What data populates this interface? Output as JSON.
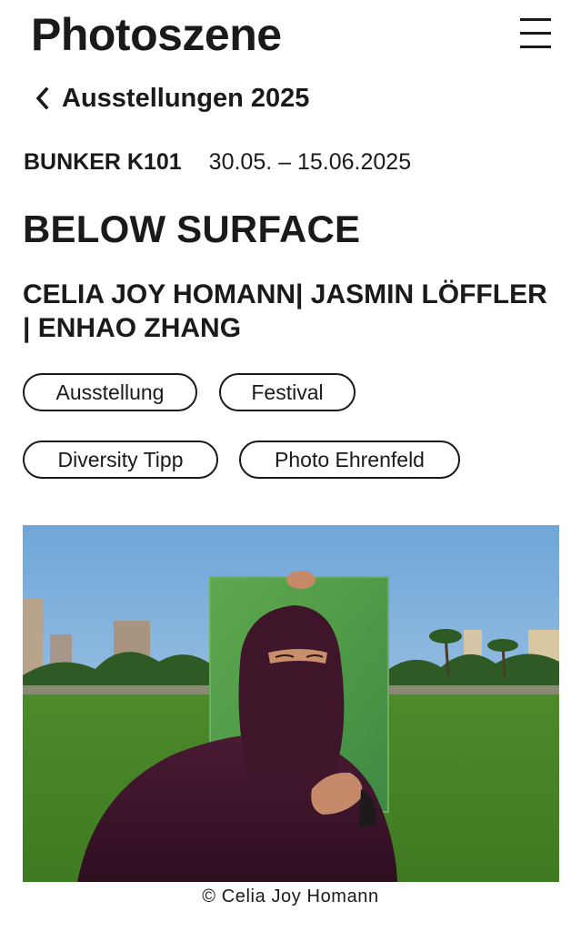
{
  "header": {
    "logo": "Photoszene",
    "menu_icon": "hamburger-menu-icon"
  },
  "back_link": {
    "label": "Ausstellungen 2025",
    "icon": "chevron-left-icon"
  },
  "event": {
    "venue": "BUNKER K101",
    "dates": "30.05. – 15.06.2025",
    "title": "BELOW SURFACE",
    "artists": "CELIA JOY HOMANN| JASMIN LÖFFLER | ENHAO ZHANG"
  },
  "tags": [
    "Ausstellung",
    "Festival",
    "Diversity Tipp",
    "Photo Ehrenfeld"
  ],
  "photo": {
    "credit": "© Celia Joy Homann"
  },
  "colors": {
    "text": "#1a1a1a",
    "background": "#ffffff",
    "sky": "#8db8de",
    "grass": "#4f8a2c",
    "garment": "#3a1428"
  }
}
